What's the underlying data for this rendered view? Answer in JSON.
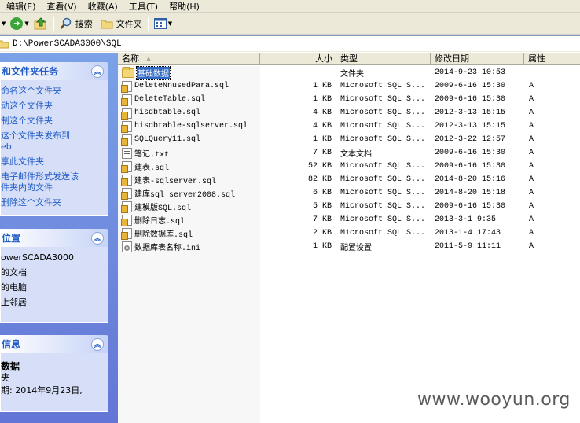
{
  "menubar": {
    "items": [
      "编辑(E)",
      "查看(V)",
      "收藏(A)",
      "工具(T)",
      "帮助(H)"
    ]
  },
  "toolbar": {
    "search_label": "搜索",
    "folders_label": "文件夹"
  },
  "address": {
    "path": "D:\\PowerSCADA3000\\SQL"
  },
  "taskpane": {
    "file_tasks": {
      "title": "和文件夹任务",
      "links": [
        "命名这个文件夹",
        "动这个文件夹",
        "制这个文件夹",
        "这个文件夹发布到\neb",
        "享此文件夹",
        "电子邮件形式发送该\n件夹内的文件",
        "删除这个文件夹"
      ]
    },
    "other_places": {
      "title": "位置",
      "links": [
        "owerSCADA3000",
        "的文档",
        "的电脑",
        "上邻居"
      ]
    },
    "details": {
      "title": "信息",
      "name": "数据",
      "type": "夹",
      "modified": "期: 2014年9月23日,"
    }
  },
  "filelist": {
    "columns": {
      "name": "名称",
      "size": "大小",
      "type": "类型",
      "date": "修改日期",
      "attr": "属性"
    },
    "rows": [
      {
        "icon": "folder",
        "name": "基础数据",
        "size": "",
        "type": "文件夹",
        "date": "2014-9-23 10:53",
        "attr": ""
      },
      {
        "icon": "sql",
        "name": "DeleteNnusedPara.sql",
        "size": "1 KB",
        "type": "Microsoft SQL S...",
        "date": "2009-6-16 15:30",
        "attr": "A"
      },
      {
        "icon": "sql",
        "name": "DeleteTable.sql",
        "size": "1 KB",
        "type": "Microsoft SQL S...",
        "date": "2009-6-16 15:30",
        "attr": "A"
      },
      {
        "icon": "sql",
        "name": "hisdbtable.sql",
        "size": "4 KB",
        "type": "Microsoft SQL S...",
        "date": "2012-3-13 15:15",
        "attr": "A"
      },
      {
        "icon": "sql",
        "name": "hisdbtable-sqlserver.sql",
        "size": "4 KB",
        "type": "Microsoft SQL S...",
        "date": "2012-3-13 15:15",
        "attr": "A"
      },
      {
        "icon": "sql",
        "name": "SQLQuery11.sql",
        "size": "1 KB",
        "type": "Microsoft SQL S...",
        "date": "2012-3-22 12:57",
        "attr": "A"
      },
      {
        "icon": "txt",
        "name": "笔记.txt",
        "size": "7 KB",
        "type": "文本文档",
        "date": "2009-6-16 15:30",
        "attr": "A"
      },
      {
        "icon": "sql",
        "name": "建表.sql",
        "size": "52 KB",
        "type": "Microsoft SQL S...",
        "date": "2009-6-16 15:30",
        "attr": "A"
      },
      {
        "icon": "sql",
        "name": "建表-sqlserver.sql",
        "size": "82 KB",
        "type": "Microsoft SQL S...",
        "date": "2014-8-20 15:16",
        "attr": "A"
      },
      {
        "icon": "sql",
        "name": "建库sql server2008.sql",
        "size": "6 KB",
        "type": "Microsoft SQL S...",
        "date": "2014-8-20 15:18",
        "attr": "A"
      },
      {
        "icon": "sql",
        "name": "建模版SQL.sql",
        "size": "5 KB",
        "type": "Microsoft SQL S...",
        "date": "2009-6-16 15:30",
        "attr": "A"
      },
      {
        "icon": "sql",
        "name": "删除日志.sql",
        "size": "7 KB",
        "type": "Microsoft SQL S...",
        "date": "2013-3-1 9:35",
        "attr": "A"
      },
      {
        "icon": "sql",
        "name": "删除数据库.sql",
        "size": "2 KB",
        "type": "Microsoft SQL S...",
        "date": "2013-1-4 17:43",
        "attr": "A"
      },
      {
        "icon": "ini",
        "name": "数据库表名称.ini",
        "size": "1 KB",
        "type": "配置设置",
        "date": "2011-5-9 11:11",
        "attr": "A"
      }
    ]
  },
  "watermark": "www.wooyun.org"
}
